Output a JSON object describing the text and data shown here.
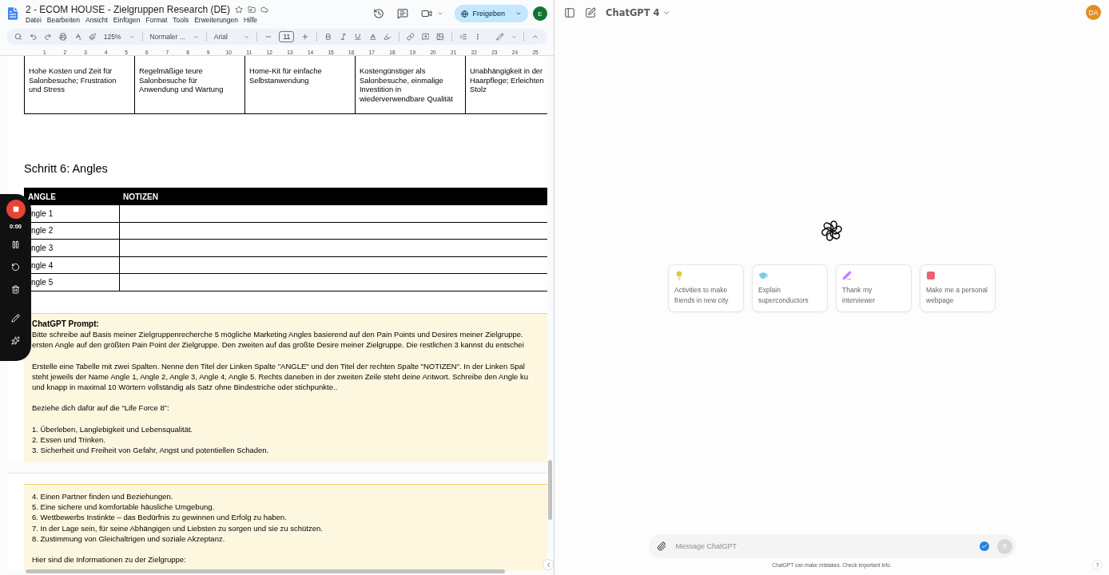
{
  "docs": {
    "title": "2 - ECOM HOUSE - Zielgruppen Research (DE)",
    "menu": [
      "Datei",
      "Bearbeiten",
      "Ansicht",
      "Einfügen",
      "Format",
      "Tools",
      "Erweiterungen",
      "Hilfe"
    ],
    "share_label": "Freigeben",
    "account_initial": "E",
    "toolbar": {
      "zoom": "125%",
      "style": "Normaler ...",
      "font": "Arial",
      "font_size": "11"
    },
    "ruler_marks": [
      "1",
      "2",
      "3",
      "4",
      "5",
      "6",
      "7",
      "8",
      "9",
      "10",
      "11",
      "12",
      "13",
      "14",
      "15",
      "16",
      "17",
      "18",
      "19",
      "20",
      "21",
      "22",
      "23",
      "24",
      "25"
    ],
    "pain_row": [
      "Hohe Kosten und Zeit für\nSalonbesuche; Frustration\nund Stress",
      "Regelmäßige teure\nSalonbesuche für\nAnwendung und Wartung",
      "Home-Kit für einfache\nSelbstanwendung",
      "Kostengünstiger als\nSalonbesuche, einmalige\nInvestition in\nwiederverwendbare Qualität",
      "Unabhängigkeit in der\nHaarpflege; Erleichten\nStolz"
    ],
    "heading": "Schritt 6: Angles",
    "angles_table": {
      "columns": [
        "ANGLE",
        "NOTIZEN"
      ],
      "rows": [
        "ngle 1",
        "ngle 2",
        "ngle 3",
        "ngle 4",
        "ngle 5"
      ]
    },
    "prompt_title": "ChatGPT Prompt:",
    "prompt_paragraphs": [
      "Bitte schreibe auf Basis meiner Zielgruppenrecherche 5 mögliche Marketing Angles basierend auf den Pain Points und Desires meiner Zielgruppe.\nersten Angle auf den größten Pain Point der Zielgruppe. Den zweiten auf das größte Desire meiner Zielgruppe. Die restlichen 3 kannst du entschei",
      "Erstelle eine Tabelle mit zwei Spalten. Nenne den Titel der Linken Spalte \"ANGLE\" und den Titel der rechten Spalte \"NOTIZEN\". In der Linken Spal\nsteht jeweils der Name Angle 1, Angle 2, Angle 3, Angle 4, Angle 5. Rechts daneben in der zweiten Zeile steht deine Antwort. Schreibe den Angle ku\nund knapp in maximal 10 Wörtern vollständig als Satz ohne Bindestriche oder stichpunkte..",
      "Beziehe dich dafür auf die “Life Force 8”:",
      "1. Überleben, Langlebigkeit und Lebensqualität.\n2. Essen und Trinken.\n3. Sicherheit und Freiheit von Gefahr, Angst und potentiellen Schaden."
    ],
    "page2_paragraphs": [
      "4. Einen Partner finden und Beziehungen.\n5. Eine sichere und komfortable häusliche Umgebung.\n6. Wettbewerbs Instinkte – das Bedürfnis zu gewinnen und Erfolg zu haben.\n7. In der Lage sein, für seine Abhängigen und Liebsten zu sorgen und sie zu schützen.\n8. Zustimmung von Gleichaltrigen und soziale Akzeptanz.",
      "Hier sind die Informationen zu der Zielgruppe:"
    ],
    "recorder": {
      "time": "0:00"
    }
  },
  "chat": {
    "model": "ChatGPT 4",
    "avatar": "DA",
    "suggestions": [
      {
        "kind": "idea",
        "text": "Activities to make\nfriends in new city",
        "color": "#e2c541"
      },
      {
        "kind": "learn",
        "text": "Explain\nsuperconductors",
        "color": "#76d0eb"
      },
      {
        "kind": "write",
        "text": "Thank my\ninterviewer",
        "color": "#c083fb"
      },
      {
        "kind": "code",
        "text": "Make me a personal\nwebpage",
        "color": "#e86374"
      }
    ],
    "input": {
      "placeholder": "Message ChatGPT"
    },
    "disclaimer": "ChatGPT can make mistakes. Check important info.",
    "help": "?"
  }
}
